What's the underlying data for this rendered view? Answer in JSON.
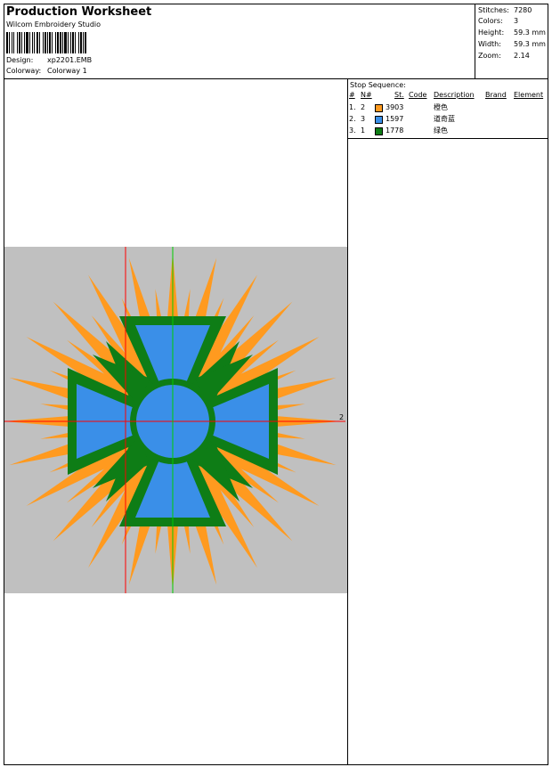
{
  "header": {
    "title": "Production Worksheet",
    "subtitle": "Wilcom Embroidery Studio",
    "design_label": "Design:",
    "design_value": "xp2201.EMB",
    "colorway_label": "Colorway:",
    "colorway_value": "Colorway 1"
  },
  "stats": [
    {
      "label": "Stitches:",
      "value": "7280"
    },
    {
      "label": "Colors:",
      "value": "3"
    },
    {
      "label": "Height:",
      "value": "59.3 mm"
    },
    {
      "label": "Width:",
      "value": "59.3 mm"
    },
    {
      "label": "Zoom:",
      "value": "2.14"
    }
  ],
  "stop_sequence": {
    "title": "Stop Sequence:",
    "columns": [
      "#",
      "N#",
      "St.",
      "Code",
      "Description",
      "Brand",
      "Element"
    ],
    "rows": [
      {
        "index": "1.",
        "n": "2",
        "code": "3903",
        "description": "橙色",
        "color": "#ff9a1f"
      },
      {
        "index": "2.",
        "n": "3",
        "code": "1597",
        "description": "道奇蓝",
        "color": "#3a8fe8"
      },
      {
        "index": "3.",
        "n": "1",
        "code": "1778",
        "description": "绿色",
        "color": "#0e7d16"
      }
    ]
  },
  "design": {
    "background_color": "#c0c0c0",
    "axis_label": "2",
    "colors": {
      "orange": "#ff9a1f",
      "blue": "#3a8fe8",
      "green": "#0e7d16",
      "red_axis": "#ff0000",
      "green_axis": "#00cc00"
    }
  }
}
